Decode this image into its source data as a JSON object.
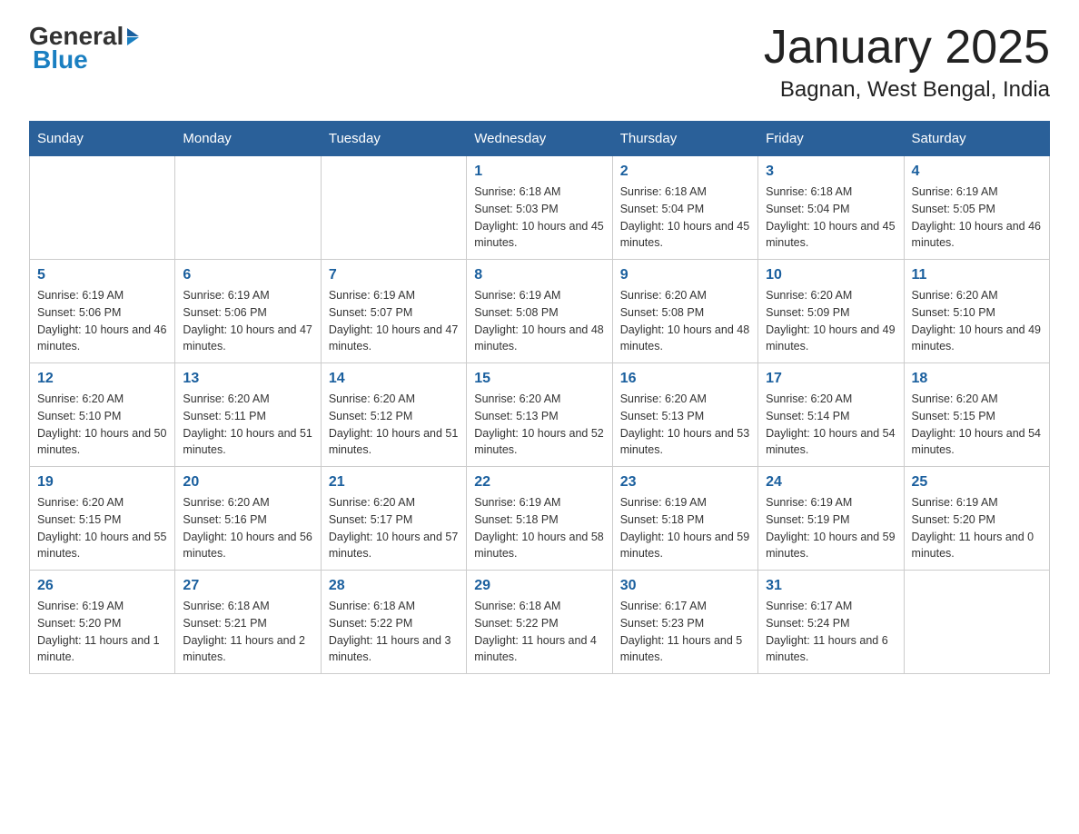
{
  "logo": {
    "general": "General",
    "arrow": "▶",
    "blue": "Blue"
  },
  "title": "January 2025",
  "subtitle": "Bagnan, West Bengal, India",
  "days_header": [
    "Sunday",
    "Monday",
    "Tuesday",
    "Wednesday",
    "Thursday",
    "Friday",
    "Saturday"
  ],
  "weeks": [
    [
      {
        "day": "",
        "info": ""
      },
      {
        "day": "",
        "info": ""
      },
      {
        "day": "",
        "info": ""
      },
      {
        "day": "1",
        "info": "Sunrise: 6:18 AM\nSunset: 5:03 PM\nDaylight: 10 hours and 45 minutes."
      },
      {
        "day": "2",
        "info": "Sunrise: 6:18 AM\nSunset: 5:04 PM\nDaylight: 10 hours and 45 minutes."
      },
      {
        "day": "3",
        "info": "Sunrise: 6:18 AM\nSunset: 5:04 PM\nDaylight: 10 hours and 45 minutes."
      },
      {
        "day": "4",
        "info": "Sunrise: 6:19 AM\nSunset: 5:05 PM\nDaylight: 10 hours and 46 minutes."
      }
    ],
    [
      {
        "day": "5",
        "info": "Sunrise: 6:19 AM\nSunset: 5:06 PM\nDaylight: 10 hours and 46 minutes."
      },
      {
        "day": "6",
        "info": "Sunrise: 6:19 AM\nSunset: 5:06 PM\nDaylight: 10 hours and 47 minutes."
      },
      {
        "day": "7",
        "info": "Sunrise: 6:19 AM\nSunset: 5:07 PM\nDaylight: 10 hours and 47 minutes."
      },
      {
        "day": "8",
        "info": "Sunrise: 6:19 AM\nSunset: 5:08 PM\nDaylight: 10 hours and 48 minutes."
      },
      {
        "day": "9",
        "info": "Sunrise: 6:20 AM\nSunset: 5:08 PM\nDaylight: 10 hours and 48 minutes."
      },
      {
        "day": "10",
        "info": "Sunrise: 6:20 AM\nSunset: 5:09 PM\nDaylight: 10 hours and 49 minutes."
      },
      {
        "day": "11",
        "info": "Sunrise: 6:20 AM\nSunset: 5:10 PM\nDaylight: 10 hours and 49 minutes."
      }
    ],
    [
      {
        "day": "12",
        "info": "Sunrise: 6:20 AM\nSunset: 5:10 PM\nDaylight: 10 hours and 50 minutes."
      },
      {
        "day": "13",
        "info": "Sunrise: 6:20 AM\nSunset: 5:11 PM\nDaylight: 10 hours and 51 minutes."
      },
      {
        "day": "14",
        "info": "Sunrise: 6:20 AM\nSunset: 5:12 PM\nDaylight: 10 hours and 51 minutes."
      },
      {
        "day": "15",
        "info": "Sunrise: 6:20 AM\nSunset: 5:13 PM\nDaylight: 10 hours and 52 minutes."
      },
      {
        "day": "16",
        "info": "Sunrise: 6:20 AM\nSunset: 5:13 PM\nDaylight: 10 hours and 53 minutes."
      },
      {
        "day": "17",
        "info": "Sunrise: 6:20 AM\nSunset: 5:14 PM\nDaylight: 10 hours and 54 minutes."
      },
      {
        "day": "18",
        "info": "Sunrise: 6:20 AM\nSunset: 5:15 PM\nDaylight: 10 hours and 54 minutes."
      }
    ],
    [
      {
        "day": "19",
        "info": "Sunrise: 6:20 AM\nSunset: 5:15 PM\nDaylight: 10 hours and 55 minutes."
      },
      {
        "day": "20",
        "info": "Sunrise: 6:20 AM\nSunset: 5:16 PM\nDaylight: 10 hours and 56 minutes."
      },
      {
        "day": "21",
        "info": "Sunrise: 6:20 AM\nSunset: 5:17 PM\nDaylight: 10 hours and 57 minutes."
      },
      {
        "day": "22",
        "info": "Sunrise: 6:19 AM\nSunset: 5:18 PM\nDaylight: 10 hours and 58 minutes."
      },
      {
        "day": "23",
        "info": "Sunrise: 6:19 AM\nSunset: 5:18 PM\nDaylight: 10 hours and 59 minutes."
      },
      {
        "day": "24",
        "info": "Sunrise: 6:19 AM\nSunset: 5:19 PM\nDaylight: 10 hours and 59 minutes."
      },
      {
        "day": "25",
        "info": "Sunrise: 6:19 AM\nSunset: 5:20 PM\nDaylight: 11 hours and 0 minutes."
      }
    ],
    [
      {
        "day": "26",
        "info": "Sunrise: 6:19 AM\nSunset: 5:20 PM\nDaylight: 11 hours and 1 minute."
      },
      {
        "day": "27",
        "info": "Sunrise: 6:18 AM\nSunset: 5:21 PM\nDaylight: 11 hours and 2 minutes."
      },
      {
        "day": "28",
        "info": "Sunrise: 6:18 AM\nSunset: 5:22 PM\nDaylight: 11 hours and 3 minutes."
      },
      {
        "day": "29",
        "info": "Sunrise: 6:18 AM\nSunset: 5:22 PM\nDaylight: 11 hours and 4 minutes."
      },
      {
        "day": "30",
        "info": "Sunrise: 6:17 AM\nSunset: 5:23 PM\nDaylight: 11 hours and 5 minutes."
      },
      {
        "day": "31",
        "info": "Sunrise: 6:17 AM\nSunset: 5:24 PM\nDaylight: 11 hours and 6 minutes."
      },
      {
        "day": "",
        "info": ""
      }
    ]
  ]
}
